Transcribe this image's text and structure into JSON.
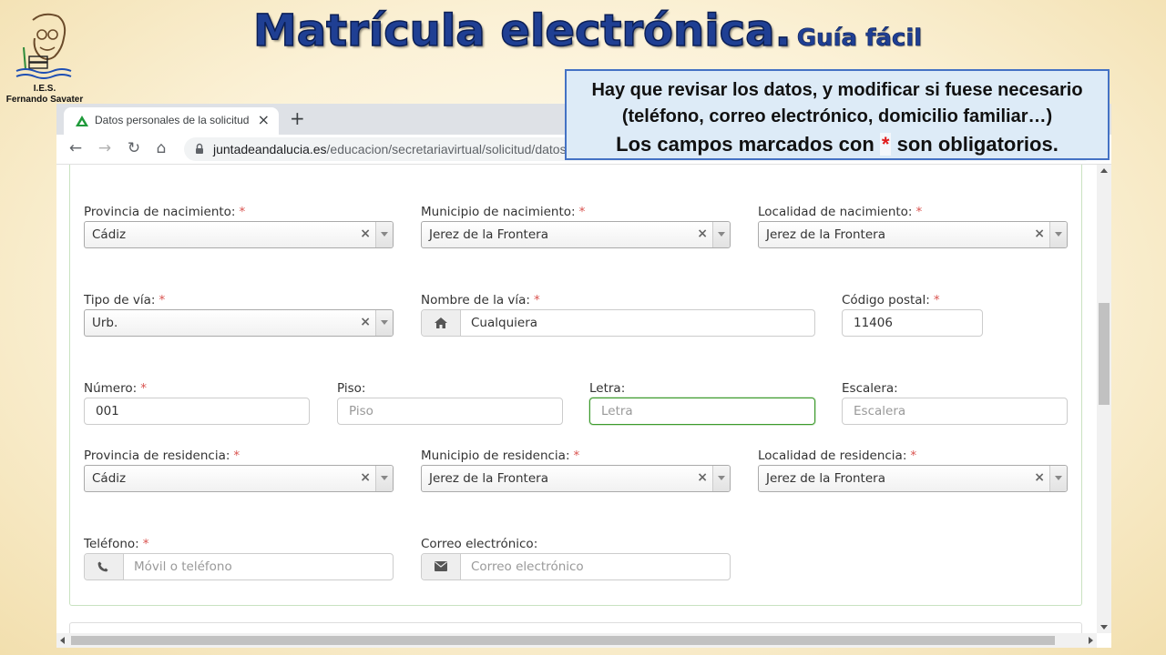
{
  "slide": {
    "title": "Matrícula electrónica.",
    "subtitle": "Guía fácil",
    "logo_line1": "I.E.S.",
    "logo_line2": "Fernando Savater"
  },
  "callout": {
    "line1": "Hay que revisar los datos, y modificar si fuese necesario",
    "line2": "(teléfono, correo electrónico, domicilio familiar…)",
    "line3_before": "Los campos marcados con",
    "line3_star": "*",
    "line3_after": "son obligatorios."
  },
  "browser": {
    "tab_title": "Datos personales de la solicitud",
    "tab_close": "×",
    "new_tab": "+",
    "url_domain": "juntadeandalucia.es",
    "url_path": "/educacion/secretariavirtual/solicitud/datos",
    "back": "←",
    "forward": "→",
    "reload": "↻",
    "home": "⌂"
  },
  "form": {
    "required_mark": "*",
    "clear_mark": "×",
    "provincia_nacimiento": {
      "label": "Provincia de nacimiento:",
      "value": "Cádiz"
    },
    "municipio_nacimiento": {
      "label": "Municipio de nacimiento:",
      "value": "Jerez de la Frontera"
    },
    "localidad_nacimiento": {
      "label": "Localidad de nacimiento:",
      "value": "Jerez de la Frontera"
    },
    "tipo_via": {
      "label": "Tipo de vía:",
      "value": "Urb."
    },
    "nombre_via": {
      "label": "Nombre de la vía:",
      "value": "Cualquiera"
    },
    "codigo_postal": {
      "label": "Código postal:",
      "value": "11406"
    },
    "numero": {
      "label": "Número:",
      "value": "001"
    },
    "piso": {
      "label": "Piso:",
      "placeholder": "Piso"
    },
    "letra": {
      "label": "Letra:",
      "placeholder": "Letra"
    },
    "escalera": {
      "label": "Escalera:",
      "placeholder": "Escalera"
    },
    "provincia_residencia": {
      "label": "Provincia de residencia:",
      "value": "Cádiz"
    },
    "municipio_residencia": {
      "label": "Municipio de residencia:",
      "value": "Jerez de la Frontera"
    },
    "localidad_residencia": {
      "label": "Localidad de residencia:",
      "value": "Jerez de la Frontera"
    },
    "telefono": {
      "label": "Teléfono:",
      "placeholder": "Móvil o teléfono"
    },
    "correo": {
      "label": "Correo electrónico:",
      "placeholder": "Correo electrónico"
    }
  },
  "icons": {
    "logo": "school-logo-icon",
    "favicon": "junta-andalucia-favicon-icon",
    "lock": "lock-icon",
    "home_addon": "home-icon",
    "phone_addon": "phone-icon",
    "mail_addon": "envelope-icon"
  },
  "colors": {
    "title": "#1f3f93",
    "callout_bg": "#ddebf7",
    "callout_border": "#4472c4",
    "required": "#d9534f",
    "focus_border": "#3c9a2c",
    "favicon": "#1f9a3a"
  }
}
